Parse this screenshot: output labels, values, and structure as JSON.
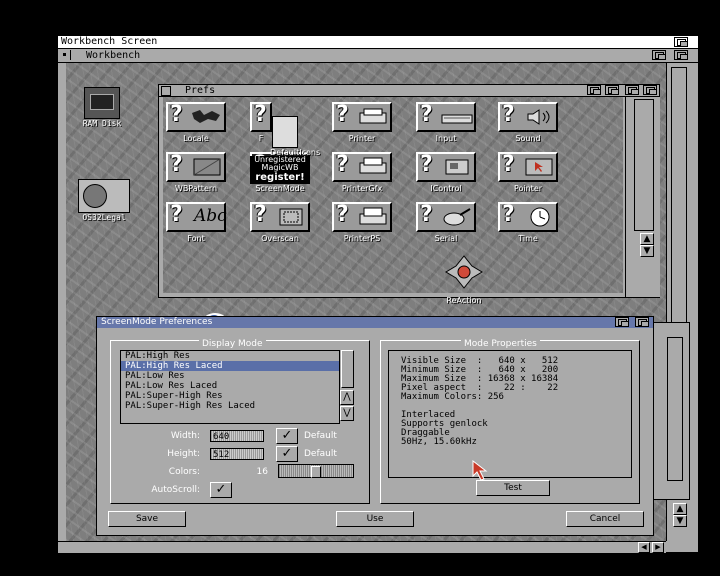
{
  "screen": {
    "title": "Workbench Screen"
  },
  "workbench": {
    "title": "Workbench"
  },
  "desktop_icons": [
    {
      "label": "RAM Disk"
    },
    {
      "label": "OS32Legal"
    }
  ],
  "prefs": {
    "title": "Prefs",
    "icons": [
      "Locale",
      "F",
      "Printer",
      "Input",
      "Sound",
      "WBPattern",
      "ScreenMode",
      "PrinterGfx",
      "IControl",
      "Pointer",
      "Font",
      "Overscan",
      "PrinterPS",
      "Serial",
      "Time",
      "ReAction"
    ],
    "overlay": {
      "line1": "DefaultIcons",
      "line2": "Unregistered",
      "line3": "MagicWB",
      "line4": "register!"
    }
  },
  "screenmode": {
    "title": "ScreenMode Preferences",
    "display_mode_title": "Display Mode",
    "modes": [
      "PAL:High Res",
      "PAL:High Res Laced",
      "PAL:Low Res",
      "PAL:Low Res Laced",
      "PAL:Super-High Res",
      "PAL:Super-High Res Laced"
    ],
    "selected_index": 1,
    "width_label": "Width:",
    "width_value": "640",
    "width_default": "Default",
    "height_label": "Height:",
    "height_value": "512",
    "height_default": "Default",
    "colors_label": "Colors:",
    "colors_value": "16",
    "autoscroll_label": "AutoScroll:",
    "props_title": "Mode Properties",
    "props": [
      "Visible Size  :   640 x   512",
      "Minimum Size  :   640 x   200",
      "Maximum Size  : 16368 x 16384",
      "Pixel aspect  :    22 :    22",
      "Maximum Colors: 256",
      "",
      "Interlaced",
      "Supports genlock",
      "Draggable",
      "50Hz, 15.60kHz"
    ],
    "test_label": "Test",
    "save_label": "Save",
    "use_label": "Use",
    "cancel_label": "Cancel"
  }
}
